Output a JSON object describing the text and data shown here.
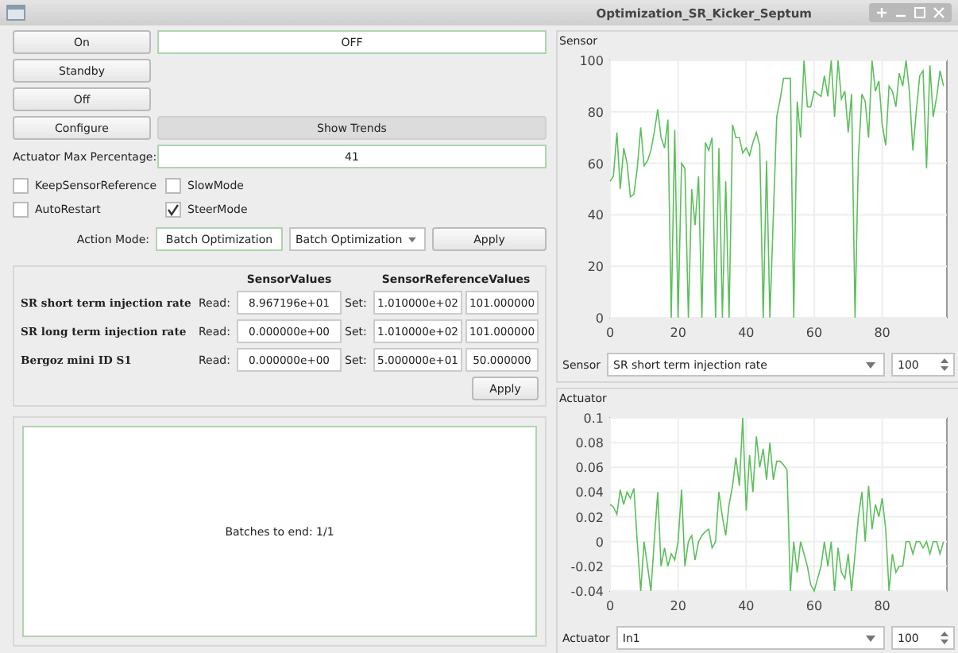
{
  "window": {
    "title": "Optimization_SR_Kicker_Septum"
  },
  "state_buttons": [
    "On",
    "Standby",
    "Off"
  ],
  "state_field": {
    "value": "OFF"
  },
  "configure_button": "Configure",
  "show_trends_button": "Show Trends",
  "actuator_max": {
    "label": "Actuator Max Percentage:",
    "value": "41"
  },
  "options": [
    {
      "label": "KeepSensorReference",
      "checked": false
    },
    {
      "label": "SlowMode",
      "checked": false
    },
    {
      "label": "AutoRestart",
      "checked": false
    },
    {
      "label": "SteerMode",
      "checked": true
    }
  ],
  "action_mode": {
    "label": "Action Mode:",
    "current": "Batch Optimization",
    "dropdown": "Batch Optimization",
    "apply": "Apply"
  },
  "sensor_table": {
    "columns": [
      "SensorValues",
      "SensorReferenceValues"
    ],
    "rows": [
      {
        "name": "SR short term injection rate",
        "read_label": "Read:",
        "read": "8.967196e+01",
        "set_label": "Set:",
        "set": "1.010000e+02",
        "reference": "101.000000"
      },
      {
        "name": "SR long term injection rate",
        "read_label": "Read:",
        "read": "0.000000e+00",
        "set_label": "Set:",
        "set": "1.010000e+02",
        "reference": "101.000000"
      },
      {
        "name": "Bergoz mini ID S1",
        "read_label": "Read:",
        "read": "0.000000e+00",
        "set_label": "Set:",
        "set": "5.000000e+01",
        "reference": "50.000000"
      }
    ],
    "apply": "Apply"
  },
  "batch_panel": {
    "text": "Batches to end: 1/1"
  },
  "sensor_plot": {
    "title": "Sensor",
    "selector_label": "Sensor",
    "selector": "SR short term injection rate",
    "count": "100",
    "chart_data": {
      "type": "line",
      "xlim": [
        0,
        99
      ],
      "ylim": [
        0,
        100
      ],
      "xticks": [
        0,
        20,
        40,
        60,
        80
      ],
      "yticks": [
        0,
        20,
        40,
        60,
        80,
        100
      ],
      "x": [
        0,
        1,
        2,
        3,
        4,
        5,
        6,
        7,
        8,
        9,
        10,
        11,
        12,
        13,
        14,
        15,
        16,
        17,
        18,
        19,
        20,
        21,
        22,
        23,
        24,
        25,
        26,
        27,
        28,
        29,
        30,
        31,
        32,
        33,
        34,
        35,
        36,
        37,
        38,
        39,
        40,
        41,
        42,
        43,
        44,
        45,
        46,
        47,
        48,
        49,
        50,
        51,
        52,
        53,
        54,
        55,
        56,
        57,
        58,
        59,
        60,
        61,
        62,
        63,
        64,
        65,
        66,
        67,
        68,
        69,
        70,
        71,
        72,
        73,
        74,
        75,
        76,
        77,
        78,
        79,
        80,
        81,
        82,
        83,
        84,
        85,
        86,
        87,
        88,
        89,
        90,
        91,
        92,
        93,
        94,
        95,
        96,
        97,
        98
      ],
      "grid": true,
      "series": [
        {
          "color": "#5cbf5c",
          "values": [
            53,
            55,
            72,
            50,
            66,
            60,
            47,
            48,
            58,
            74,
            59,
            61,
            65,
            72,
            81,
            70,
            66,
            77,
            0,
            73,
            0,
            60,
            58,
            0,
            50,
            36,
            55,
            0,
            68,
            65,
            70,
            0,
            66,
            0,
            53,
            0,
            75,
            70,
            70,
            64,
            66,
            63,
            68,
            72,
            67,
            0,
            61,
            0,
            40,
            78,
            85,
            93,
            93,
            93,
            0,
            84,
            70,
            100,
            82,
            82,
            88,
            87,
            86,
            94,
            86,
            100,
            78,
            100,
            85,
            88,
            72,
            87,
            0,
            62,
            87,
            84,
            70,
            100,
            88,
            92,
            75,
            67,
            90,
            88,
            82,
            95,
            90,
            100,
            88,
            65,
            80,
            94,
            96,
            58,
            98,
            78,
            86,
            96,
            90
          ]
        }
      ]
    }
  },
  "actuator_plot": {
    "title": "Actuator",
    "selector_label": "Actuator",
    "selector": "In1",
    "count": "100",
    "chart_data": {
      "type": "line",
      "xlim": [
        0,
        99
      ],
      "ylim": [
        -0.04,
        0.1
      ],
      "xticks": [
        0,
        20,
        40,
        60,
        80
      ],
      "yticks": [
        -0.04,
        -0.02,
        0,
        0.02,
        0.04,
        0.06,
        0.08,
        0.1
      ],
      "x": [
        0,
        1,
        2,
        3,
        4,
        5,
        6,
        7,
        8,
        9,
        10,
        11,
        12,
        13,
        14,
        15,
        16,
        17,
        18,
        19,
        20,
        21,
        22,
        23,
        24,
        25,
        26,
        27,
        28,
        29,
        30,
        31,
        32,
        33,
        34,
        35,
        36,
        37,
        38,
        39,
        40,
        41,
        42,
        43,
        44,
        45,
        46,
        47,
        48,
        49,
        50,
        51,
        52,
        53,
        54,
        55,
        56,
        57,
        58,
        59,
        60,
        61,
        62,
        63,
        64,
        65,
        66,
        67,
        68,
        69,
        70,
        71,
        72,
        73,
        74,
        75,
        76,
        77,
        78,
        79,
        80,
        81,
        82,
        83,
        84,
        85,
        86,
        87,
        88,
        89,
        90,
        91,
        92,
        93,
        94,
        95,
        96,
        97,
        98
      ],
      "grid": true,
      "series": [
        {
          "color": "#5cbf5c",
          "values": [
            0.03,
            0.028,
            0.022,
            0.042,
            0.03,
            0.04,
            0.035,
            0.043,
            0,
            -0.04,
            0,
            -0.02,
            -0.04,
            0,
            0.04,
            -0.02,
            -0.005,
            -0.02,
            -0.01,
            -0.015,
            0,
            0.042,
            -0.02,
            0,
            0.005,
            -0.015,
            0,
            0.005,
            0.008,
            0.01,
            -0.005,
            0,
            0.04,
            0.02,
            0.005,
            0.03,
            0.045,
            0.068,
            0.045,
            0.1,
            0.025,
            0.07,
            0.04,
            0.085,
            0.06,
            0.075,
            0.05,
            0.08,
            0.05,
            0.065,
            0.065,
            0.062,
            0.058,
            -0.04,
            0,
            -0.025,
            0,
            -0.01,
            -0.02,
            -0.035,
            -0.04,
            -0.03,
            -0.02,
            0,
            -0.02,
            0,
            -0.04,
            -0.005,
            -0.025,
            -0.03,
            -0.01,
            -0.04,
            -0.01,
            0.02,
            0.04,
            0,
            0.045,
            0.01,
            0.03,
            0.02,
            0.035,
            0.01,
            -0.04,
            -0.01,
            -0.025,
            -0.02,
            -0.02,
            0,
            0,
            -0.01,
            0,
            0,
            -0.005,
            0,
            -0.01,
            0,
            0,
            -0.01,
            0
          ]
        }
      ]
    }
  }
}
